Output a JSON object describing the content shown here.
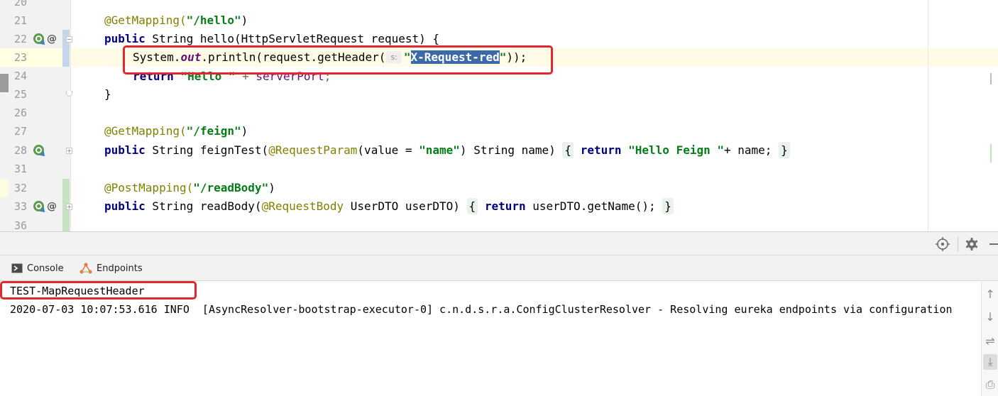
{
  "editor": {
    "lines": [
      {
        "num": "20"
      },
      {
        "num": "21",
        "annotation": "@GetMapping(",
        "string": "\"/hello\"",
        "after": ")"
      },
      {
        "num": "22",
        "kw": "public",
        "rest": " String hello(HttpServletRequest request) {"
      },
      {
        "num": "23",
        "prefix": "System.",
        "field": "out",
        "middle": ".println(request.getHeader(",
        "hint": "s:",
        "quote_open": "\"",
        "selected": "X-Request-red",
        "quote_close": "\"",
        "tail": "));"
      },
      {
        "num": "24",
        "kw": "return",
        "string": "\"Hello \"",
        "rest": " + ",
        "field": "serverPort",
        "end": ";"
      },
      {
        "num": "25",
        "text": "}"
      },
      {
        "num": "26"
      },
      {
        "num": "27",
        "annotation": "@GetMapping(",
        "string": "\"/feign\"",
        "after": ")"
      },
      {
        "num": "28",
        "kw": "public",
        "rest": " String feignTest(",
        "annotation2": "@RequestParam",
        "rest2": "(value = ",
        "string": "\"name\"",
        "rest3": ") String name) ",
        "fold_open": "{",
        "kw2": "return",
        "string2": "\"Hello Feign \"",
        "rest4": "+ name; ",
        "fold_close": "}"
      },
      {
        "num": "31"
      },
      {
        "num": "32",
        "annotation": "@PostMapping(",
        "string": "\"/readBody\"",
        "after": ")"
      },
      {
        "num": "33",
        "kw": "public",
        "rest": " String readBody(",
        "annotation2": "@RequestBody",
        "rest2": " UserDTO userDTO) ",
        "fold_open": "{",
        "kw2": "return",
        "rest3": " userDTO.getName(); ",
        "fold_close": "}"
      },
      {
        "num": "36"
      }
    ]
  },
  "tool_window": {
    "tabs": [
      {
        "label": "Console",
        "icon": "console-icon"
      },
      {
        "label": "Endpoints",
        "icon": "endpoints-icon"
      }
    ],
    "console_lines": [
      "TEST-MapRequestHeader",
      "2020-07-03 10:07:53.616 INFO  [AsyncResolver-bootstrap-executor-0] c.n.d.s.r.a.ConfigClusterResolver - Resolving eureka endpoints via configuration"
    ],
    "header_icons": [
      "crosshair-icon",
      "gear-icon",
      "minimize-icon"
    ],
    "side_icons": [
      "up-arrow-icon",
      "down-arrow-icon",
      "soft-wrap-icon",
      "scroll-to-end-icon",
      "print-icon"
    ]
  },
  "colors": {
    "highlight_box": "#e0282e",
    "selection": "#3c6aa8",
    "keyword": "#000080",
    "annotation": "#808000",
    "string": "#067d17"
  }
}
